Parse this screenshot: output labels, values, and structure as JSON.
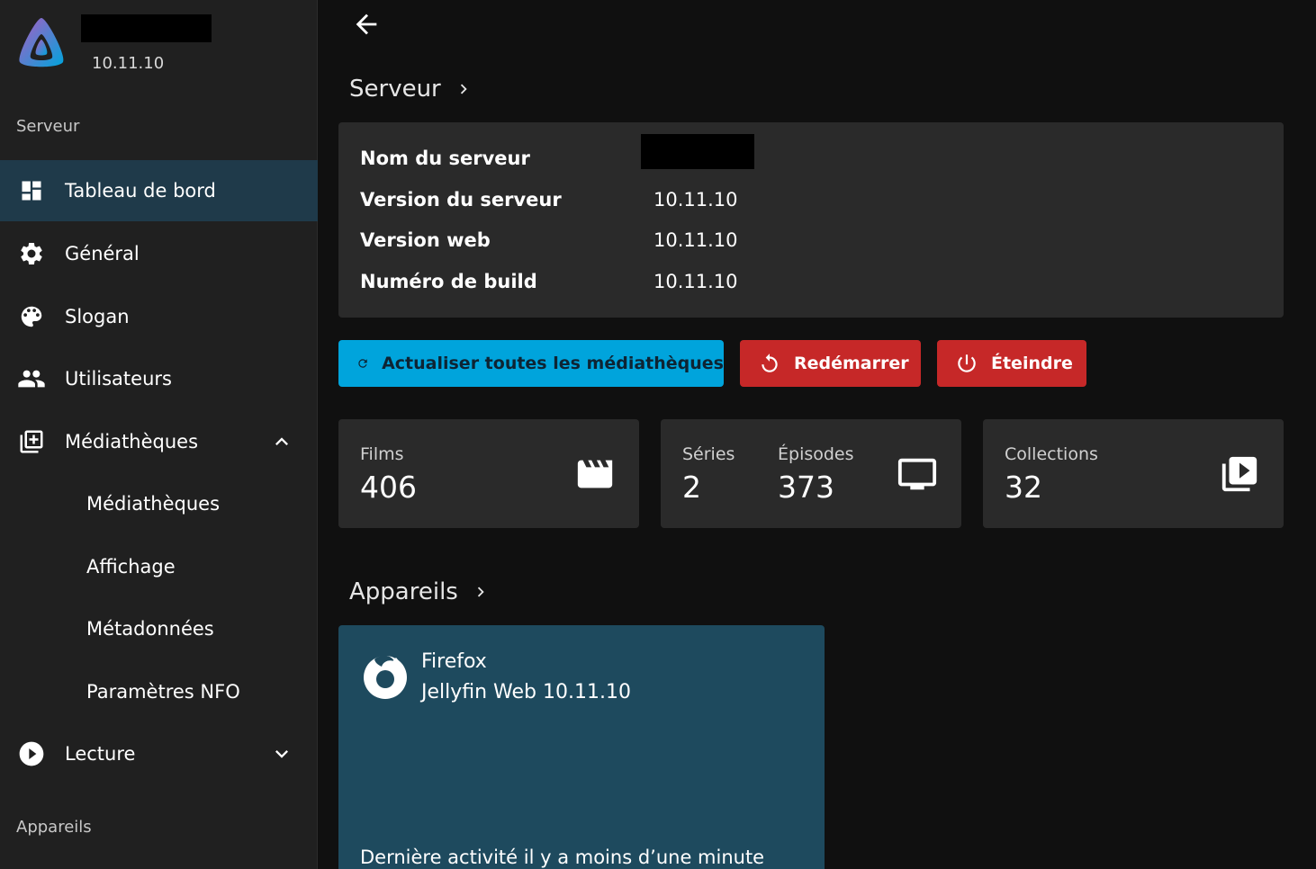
{
  "brand": {
    "version": "10.11.10"
  },
  "sidebar": {
    "section_server": "Serveur",
    "items": [
      {
        "label": "Tableau de bord",
        "icon": "dashboard-icon",
        "active": true
      },
      {
        "label": "Général",
        "icon": "gear-icon"
      },
      {
        "label": "Slogan",
        "icon": "palette-icon"
      },
      {
        "label": "Utilisateurs",
        "icon": "people-icon"
      },
      {
        "label": "Médiathèques",
        "icon": "library-add-icon",
        "expanded": true
      }
    ],
    "sub_items": [
      {
        "label": "Médiathèques"
      },
      {
        "label": "Affichage"
      },
      {
        "label": "Métadonnées"
      },
      {
        "label": "Paramètres NFO"
      }
    ],
    "playback": {
      "label": "Lecture",
      "icon": "play-circle-icon"
    },
    "section_devices": "Appareils"
  },
  "main": {
    "server_heading": "Serveur",
    "info": [
      {
        "key": "Nom du serveur",
        "value": ""
      },
      {
        "key": "Version du serveur",
        "value": "10.11.10"
      },
      {
        "key": "Version web",
        "value": "10.11.10"
      },
      {
        "key": "Numéro de build",
        "value": "10.11.10"
      }
    ],
    "buttons": {
      "refresh": "Actualiser toutes les médiathèques",
      "restart": "Redémarrer",
      "shutdown": "Éteindre"
    },
    "stats": {
      "films": {
        "label": "Films",
        "value": "406"
      },
      "series": {
        "label": "Séries",
        "value": "2"
      },
      "episodes": {
        "label": "Épisodes",
        "value": "373"
      },
      "collections": {
        "label": "Collections",
        "value": "32"
      }
    },
    "devices_heading": "Appareils",
    "device": {
      "name": "Firefox",
      "app": "Jellyfin Web 10.11.10",
      "activity": "Dernière activité il y a moins d’une minute"
    }
  },
  "colors": {
    "accent": "#00a4dc",
    "danger": "#c62828",
    "active_nav": "#1f3a4a",
    "device_card": "#1e4a5e"
  }
}
